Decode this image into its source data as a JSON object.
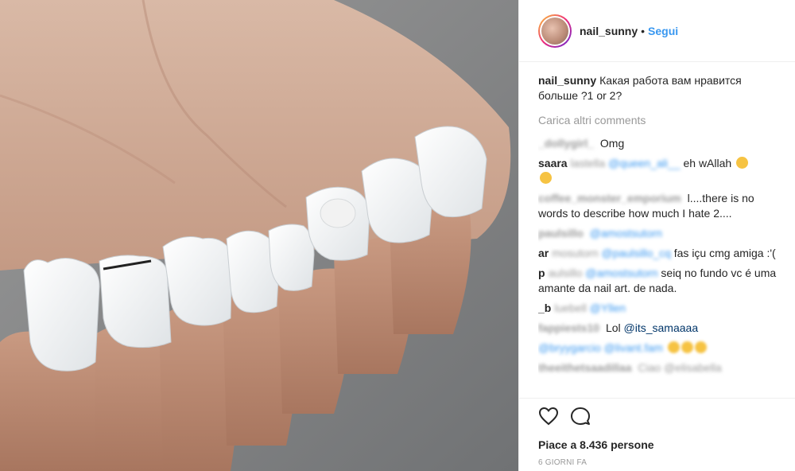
{
  "post": {
    "image_alt": "Hand with tooth-shaped nail art"
  },
  "header": {
    "username": "nail_sunny",
    "separator": "•",
    "follow_label": "Segui"
  },
  "caption": {
    "username": "nail_sunny",
    "text": "Какая работа вам нравится больше ?1 or 2?"
  },
  "load_more_label": "Carica altri comments",
  "comments": [
    {
      "user": "_dollygirl_",
      "text": "Omg",
      "blurred_user": true
    },
    {
      "user": "saara",
      "user_blur_tail": "lastella",
      "mention": "@queen_ali__",
      "text": "eh wAllah",
      "emoji": "😂"
    },
    {
      "user": "coffee_monster_emporium",
      "text": "l....there is no words to describe how much I hate 2....",
      "blurred_user": true
    },
    {
      "user": "paulsillo",
      "mention": "@amostsutorn",
      "text": "",
      "blurred_user": true
    },
    {
      "user": "ar",
      "user_blur_tail": "mosutorn",
      "mention": "@paulsillo_cq",
      "text": "fas içu cmg amiga :'("
    },
    {
      "user": "p",
      "user_blur_tail": "aulsillo",
      "mention": "@amostsutorn",
      "text": "seiq no fundo vc é uma amante da nail art. de nada."
    },
    {
      "user": "_b",
      "user_blur_tail": "luebell",
      "mention": "@Yllen",
      "text": "",
      "blurred_user": false
    },
    {
      "user": "fappiests10",
      "text": "Lol @its_samaaaa",
      "prefix_blur": "fappiests10",
      "visible_part": "Lol",
      "mention_visible": "@its_samaaaa"
    },
    {
      "user": "",
      "mention": "@bryygarcia",
      "mention_blur": "@bryygarcio @livant.fam",
      "text": ""
    },
    {
      "user": "theeithetsaadillaa",
      "text": "Ciao @elisabella",
      "blurred_user": true
    }
  ],
  "actions": {
    "like_icon": "heart-outline-icon",
    "comment_icon": "comment-bubble-icon"
  },
  "likes_text": "Piace a 8.436 persone",
  "timestamp": "6 GIORNI FA"
}
